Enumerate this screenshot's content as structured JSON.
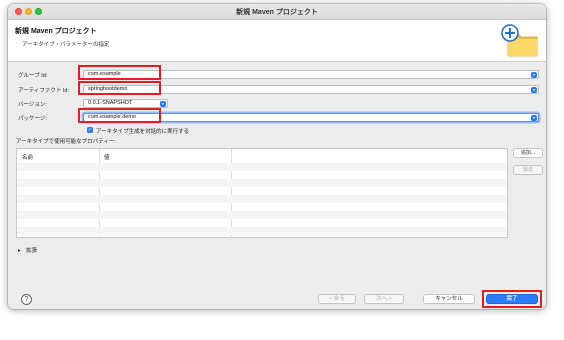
{
  "window": {
    "title": "新規 Maven プロジェクト"
  },
  "header": {
    "title": "新規 Maven プロジェクト",
    "subtitle": "アーキタイプ・パラメーターの指定"
  },
  "form": {
    "group_id": {
      "label": "グループ Id:",
      "value": "com.example"
    },
    "artifact_id": {
      "label": "アーティファクト Id:",
      "value": "springbootdemo"
    },
    "version": {
      "label": "バージョン:",
      "value": "0.0.1-SNAPSHOT"
    },
    "package": {
      "label": "パッケージ:",
      "value": "com.example.demo"
    },
    "interactive_checkbox": {
      "label": "アーキタイプ生成を対話的に実行する",
      "checked": true
    }
  },
  "properties": {
    "label": "アーキタイプで使用可能なプロパティー:",
    "columns": [
      "名前",
      "値"
    ],
    "rows": [],
    "add_button": "追加...",
    "remove_button": "除去"
  },
  "advanced": {
    "label": "拡張"
  },
  "footer": {
    "help": "?",
    "back": "< 戻る",
    "next": "次へ >",
    "cancel": "キャンセル",
    "finish": "完了"
  },
  "colors": {
    "accent": "#2a7cf6",
    "highlight": "#e02020"
  },
  "icons": {
    "help": "help-icon",
    "wizard": "folder-plus-icon",
    "combo": "chevron-down-icon"
  }
}
